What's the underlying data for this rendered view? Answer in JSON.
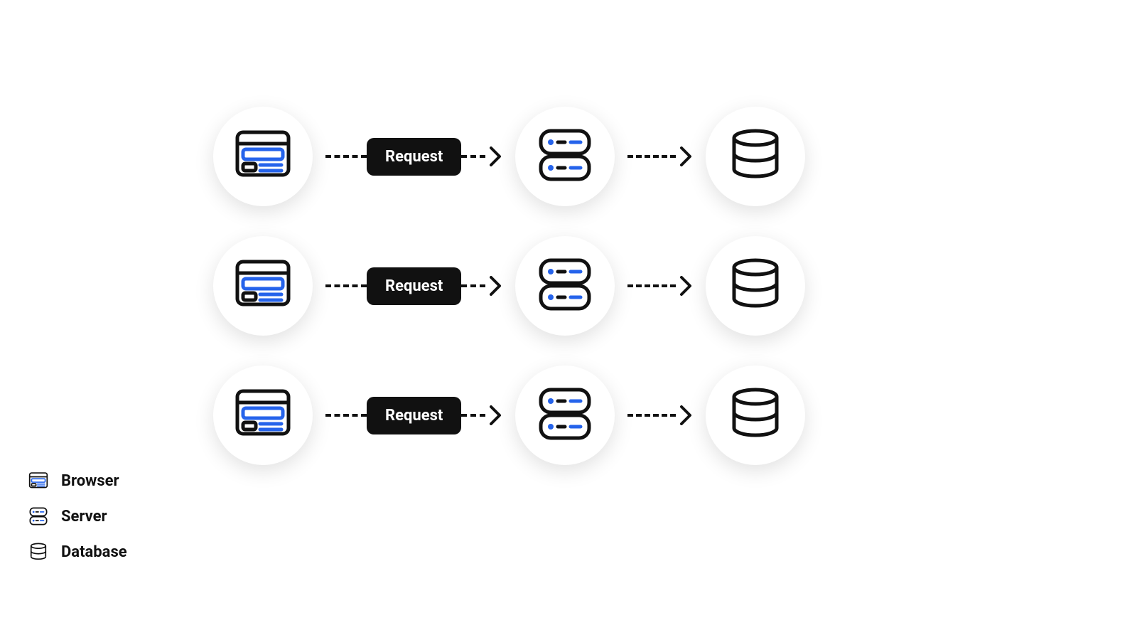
{
  "request_label": "Request",
  "legend": {
    "browser": "Browser",
    "server": "Server",
    "database": "Database"
  },
  "colors": {
    "ink": "#111111",
    "accent": "#2563eb"
  },
  "rows": 3,
  "flow": [
    "browser",
    "server",
    "database"
  ]
}
